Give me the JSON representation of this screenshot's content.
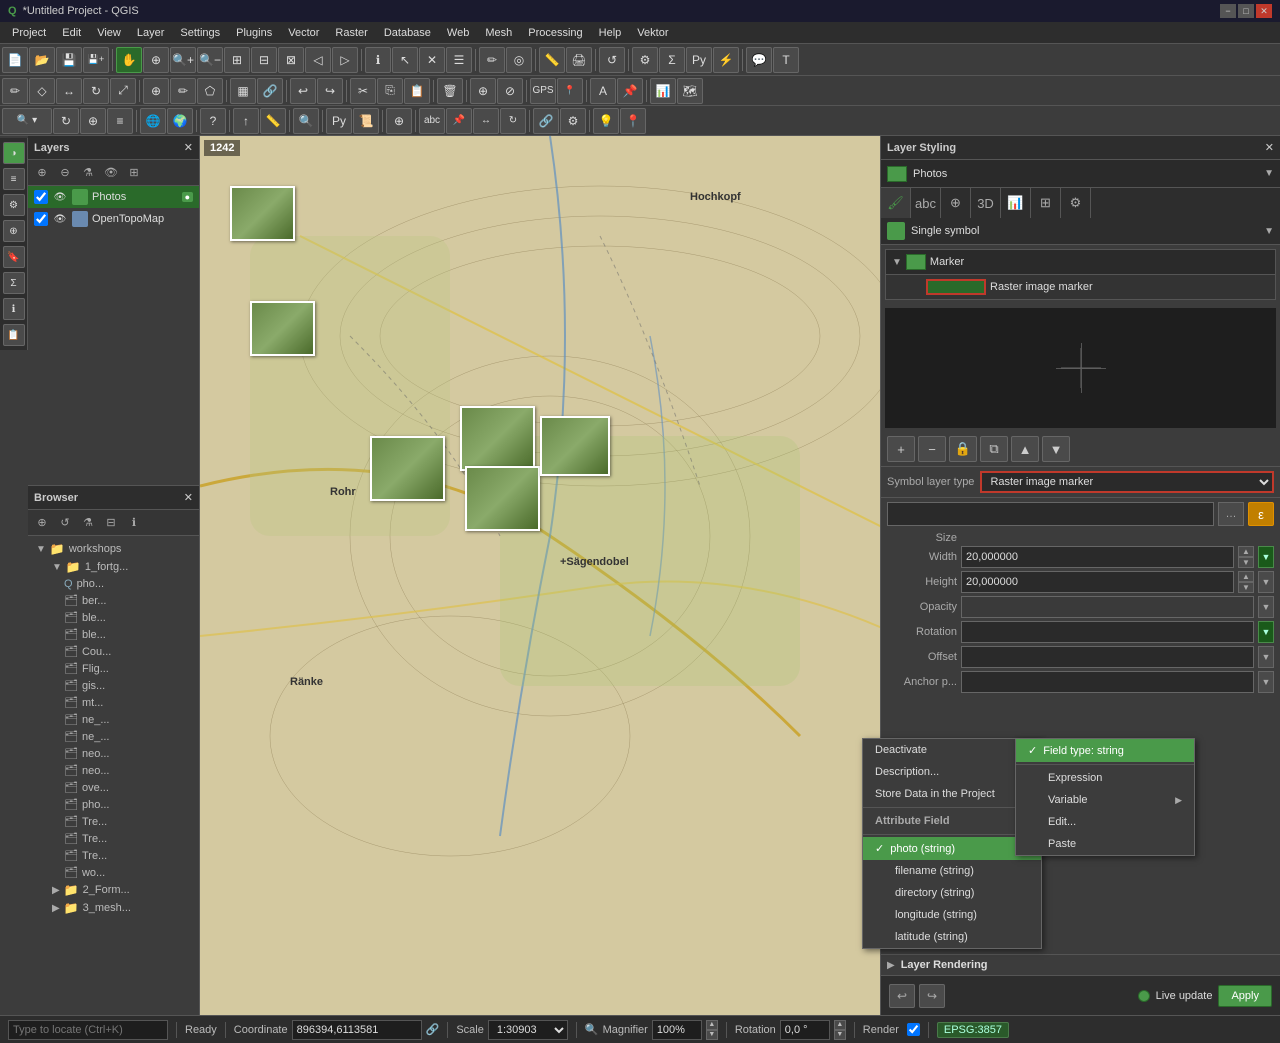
{
  "window": {
    "title": "*Untitled Project - QGIS",
    "controls": [
      "minimize",
      "maximize",
      "close"
    ]
  },
  "menubar": {
    "items": [
      "Project",
      "Edit",
      "View",
      "Layer",
      "Settings",
      "Plugins",
      "Vector",
      "Raster",
      "Database",
      "Web",
      "Mesh",
      "Processing",
      "Help",
      "Vektor"
    ]
  },
  "layers_panel": {
    "title": "Layers",
    "items": [
      {
        "name": "Photos",
        "type": "points",
        "visible": true,
        "active": true
      },
      {
        "name": "OpenTopoMap",
        "type": "raster",
        "visible": true,
        "active": false
      }
    ]
  },
  "browser_panel": {
    "title": "Browser",
    "tree_items": [
      {
        "label": "workshops",
        "indent": 0,
        "expanded": true
      },
      {
        "label": "1_fortg...",
        "indent": 1,
        "expanded": true
      },
      {
        "label": "pho...",
        "indent": 2
      },
      {
        "label": "ber...",
        "indent": 2
      },
      {
        "label": "ble...",
        "indent": 2
      },
      {
        "label": "ble...",
        "indent": 2
      },
      {
        "label": "Cou...",
        "indent": 2
      },
      {
        "label": "Flig...",
        "indent": 2
      },
      {
        "label": "gis...",
        "indent": 2
      },
      {
        "label": "mt...",
        "indent": 2
      },
      {
        "label": "ne_...",
        "indent": 2
      },
      {
        "label": "ne_...",
        "indent": 2
      },
      {
        "label": "neo...",
        "indent": 2
      },
      {
        "label": "neo...",
        "indent": 2
      },
      {
        "label": "ove...",
        "indent": 2
      },
      {
        "label": "pho...",
        "indent": 2
      },
      {
        "label": "Tre...",
        "indent": 2
      },
      {
        "label": "Tre...",
        "indent": 2
      },
      {
        "label": "Tre...",
        "indent": 2
      },
      {
        "label": "wo...",
        "indent": 2
      },
      {
        "label": "2_Form...",
        "indent": 1
      },
      {
        "label": "3_mesh...",
        "indent": 1
      }
    ]
  },
  "map": {
    "coords": "1242",
    "place_labels": [
      "Hochkopf",
      "Rohr",
      "Ränke",
      "+Sägendobel"
    ]
  },
  "layer_styling": {
    "title": "Layer Styling",
    "layer_name": "Photos",
    "symbol_type": "Single symbol",
    "marker_label": "Marker",
    "raster_image_marker": "Raster image marker",
    "symbol_layer_type_label": "Symbol layer type",
    "symbol_layer_type_value": "Raster image marker",
    "properties": {
      "size_label": "Size",
      "width_label": "Width",
      "width_value": "20,000000",
      "height_label": "Height",
      "height_value": "20,000000",
      "opacity_label": "Opacity",
      "rotation_label": "Rotation",
      "offset_label": "Offset",
      "anchor_label": "Anchor p..."
    },
    "ddo": {
      "label": "Data defined override (field)"
    },
    "attr_dropdown": {
      "items": [
        {
          "label": "photo   (string)",
          "checked": true
        },
        {
          "label": "filename  (string)",
          "checked": false
        },
        {
          "label": "directory  (string)",
          "checked": false
        },
        {
          "label": "longitude  (string)",
          "checked": false
        },
        {
          "label": "latitude  (string)",
          "checked": false
        }
      ]
    },
    "field_type_dropdown": {
      "header": "Field type: string",
      "items": [
        {
          "label": "Expression",
          "has_arrow": false
        },
        {
          "label": "Variable",
          "has_arrow": true
        },
        {
          "label": "Edit...",
          "has_arrow": false
        },
        {
          "label": "Paste",
          "has_arrow": false
        }
      ],
      "top_items": [
        {
          "label": "Deactivate",
          "has_arrow": false
        },
        {
          "label": "Description...",
          "has_arrow": false
        },
        {
          "label": "Store Data in the Project",
          "has_arrow": false
        },
        {
          "label": "Attribute Field",
          "is_header": true
        }
      ]
    },
    "layer_rendering": {
      "title": "Layer Rendering"
    },
    "bottom": {
      "live_update_label": "Live update",
      "apply_label": "Apply"
    }
  },
  "statusbar": {
    "ready": "Ready",
    "coordinate_label": "Coordinate",
    "coordinate_value": "896394,6113581",
    "scale_label": "Scale",
    "scale_value": "1:30903",
    "magnifier_label": "Magnifier",
    "magnifier_value": "100%",
    "rotation_label": "Rotation",
    "rotation_value": "0,0 °",
    "render_label": "Render",
    "epsg": "EPSG:3857"
  },
  "icons": {
    "expand": "▶",
    "collapse": "▼",
    "folder": "📁",
    "layer_points": "●",
    "layer_raster": "▦",
    "eye": "👁",
    "add": "+",
    "remove": "−",
    "filter": "⚙",
    "close": "✕",
    "minimize": "−",
    "maximize": "□",
    "check": "✓",
    "arrow_right": "▶",
    "up": "▲",
    "down": "▼",
    "undo": "↩",
    "redo": "↪",
    "lock": "🔒",
    "duplicate": "⧉",
    "save": "💾",
    "open": "📂",
    "paint": "🖌",
    "abc": "abc",
    "fx": "ε"
  }
}
